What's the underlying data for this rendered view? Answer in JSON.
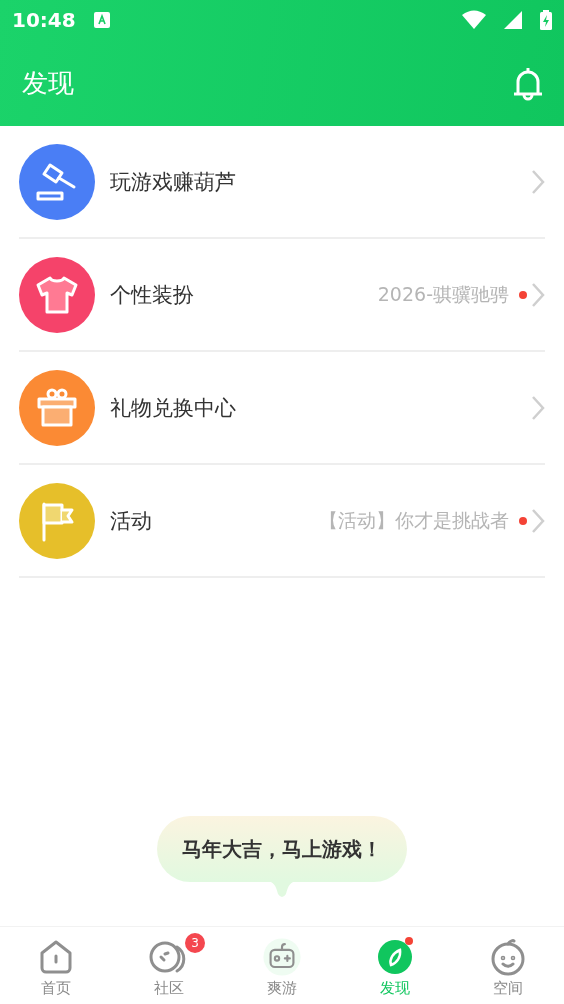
{
  "status_bar": {
    "time": "10:48"
  },
  "header": {
    "title": "发现"
  },
  "items": [
    {
      "kind": "gavel",
      "title": "玩游戏赚葫芦",
      "color": "#4a7ef5",
      "has_dot": false
    },
    {
      "kind": "shirt",
      "title": "个性装扮",
      "subtitle": "2026-骐骥驰骋",
      "color": "#f5436a",
      "has_dot": true
    },
    {
      "kind": "gift",
      "title": "礼物兑换中心",
      "color": "#fb8a34",
      "has_dot": false
    },
    {
      "kind": "flag",
      "title": "活动",
      "subtitle": "【活动】你才是挑战者",
      "color": "#e6bf2a",
      "has_dot": true
    }
  ],
  "tooltip": {
    "text": "马年大吉，马上游戏！"
  },
  "nav": [
    {
      "kind": "home",
      "label": "首页",
      "selected": false
    },
    {
      "kind": "community",
      "label": "社区",
      "selected": false,
      "badge": "3"
    },
    {
      "kind": "game",
      "label": "爽游",
      "selected": false
    },
    {
      "kind": "discover",
      "label": "发现",
      "selected": true,
      "dot": true
    },
    {
      "kind": "space",
      "label": "空间",
      "selected": false
    }
  ]
}
